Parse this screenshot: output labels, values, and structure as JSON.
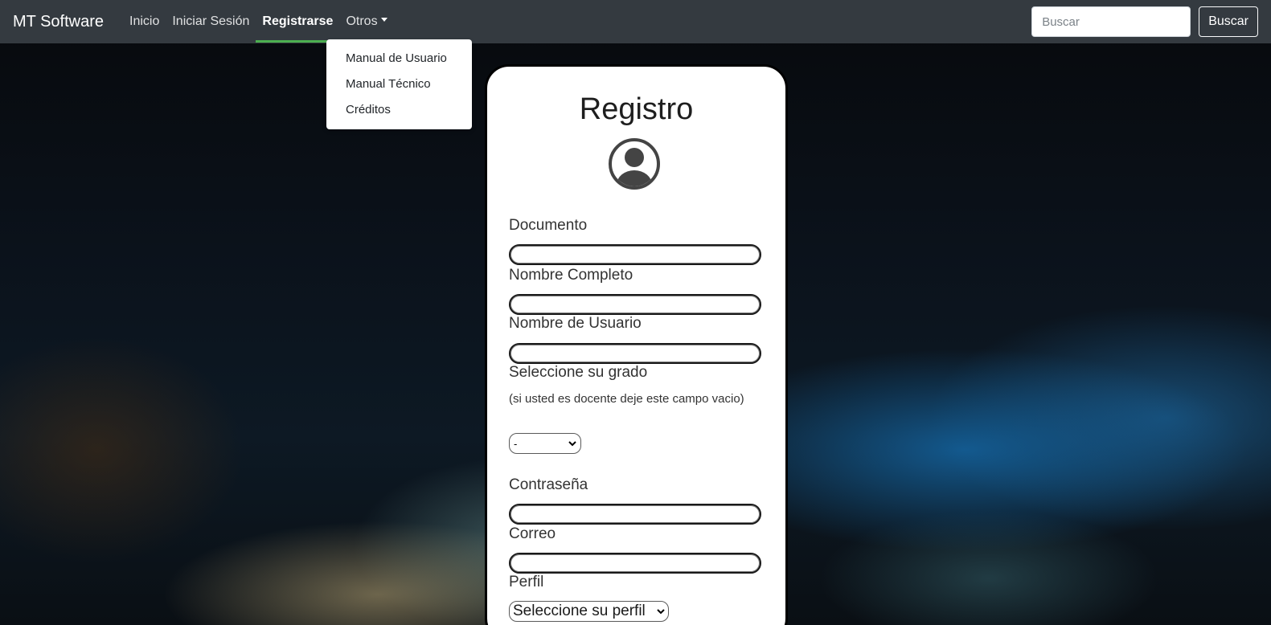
{
  "navbar": {
    "brand": "MT Software",
    "links": [
      {
        "label": "Inicio"
      },
      {
        "label": "Iniciar Sesión"
      },
      {
        "label": "Registrarse"
      },
      {
        "label": "Otros"
      }
    ],
    "search_placeholder": "Buscar",
    "search_button": "Buscar",
    "active_color": "#4caf50"
  },
  "dropdown": {
    "items": [
      {
        "label": "Manual de Usuario"
      },
      {
        "label": "Manual Técnico"
      },
      {
        "label": "Créditos"
      }
    ]
  },
  "form": {
    "title": "Registro",
    "avatar_icon": "user-circle-icon",
    "fields": {
      "documento": "Documento",
      "nombre_completo": "Nombre Completo",
      "nombre_usuario": "Nombre de Usuario",
      "grado": "Seleccione su grado",
      "grado_note": "(si usted es docente deje este campo vacio)",
      "grado_value": "-",
      "contrasena": "Contraseña",
      "correo": "Correo",
      "perfil": "Perfil",
      "perfil_value": "Seleccione su perfil"
    }
  }
}
